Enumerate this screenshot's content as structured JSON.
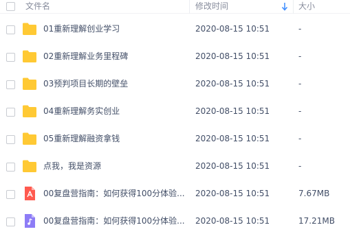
{
  "header": {
    "name_label": "文件名",
    "time_label": "修改时间",
    "size_label": "大小",
    "sort_icon": "arrow-down-icon",
    "sort_color": "#3b8cff"
  },
  "files": [
    {
      "name": "01重新理解创业学习",
      "time": "2020-08-15 10:51",
      "size": "-",
      "type": "folder",
      "icon": "folder-icon"
    },
    {
      "name": "02重新理解业务里程碑",
      "time": "2020-08-15 10:51",
      "size": "-",
      "type": "folder",
      "icon": "folder-icon"
    },
    {
      "name": "03预判项目长期的壁垒",
      "time": "2020-08-15 10:51",
      "size": "-",
      "type": "folder",
      "icon": "folder-icon"
    },
    {
      "name": "04重新理解务实创业",
      "time": "2020-08-15 10:51",
      "size": "-",
      "type": "folder",
      "icon": "folder-icon"
    },
    {
      "name": "05重新理解融资拿钱",
      "time": "2020-08-15 10:51",
      "size": "-",
      "type": "folder",
      "icon": "folder-icon"
    },
    {
      "name": "点我，我是资源",
      "time": "2020-08-15 10:51",
      "size": "-",
      "type": "folder",
      "icon": "folder-icon"
    },
    {
      "name": "00复盘营指南：如何获得100分体验...",
      "time": "2020-08-15 10:51",
      "size": "7.67MB",
      "type": "pdf",
      "icon": "pdf-file-icon"
    },
    {
      "name": "00复盘营指南：如何获得100分体验...",
      "time": "2020-08-15 10:51",
      "size": "17.21MB",
      "type": "audio",
      "icon": "audio-file-icon"
    }
  ],
  "colors": {
    "folder": "#ffc934",
    "pdf": "#ff5a4f",
    "audio": "#8d7cf6",
    "text": "#424e67",
    "header_text": "#878c9c"
  }
}
